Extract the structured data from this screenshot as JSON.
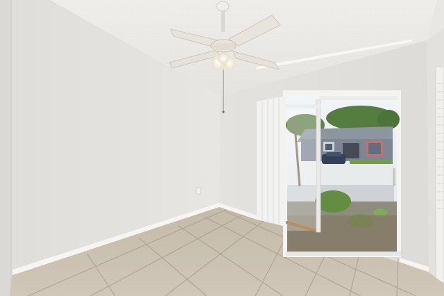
{
  "scene": {
    "subject": "empty-room-with-ceiling-fan-and-sliding-glass-door",
    "colors": {
      "wall_left": "#e6e4e0",
      "wall_back": "#e1dfdb",
      "ceiling": "#eeedea",
      "floor_tile": "#c9bfae",
      "grout": "#a99f8f",
      "baseboard": "#f6f5f2",
      "door_frame": "#f4f4f2",
      "curtain": "#f2f2f0",
      "sky": "#e9eef2",
      "foliage": "#4f7a3a",
      "house_siding": "#7a8390",
      "house_trim": "#c9d0d6",
      "car": "#2d3a52"
    }
  }
}
